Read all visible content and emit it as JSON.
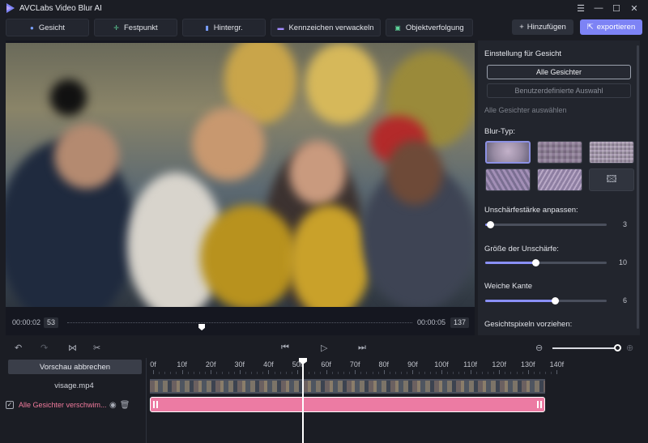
{
  "app": {
    "title": "AVCLabs Video Blur AI"
  },
  "window_controls": [
    "menu-icon",
    "minimize-icon",
    "maximize-icon",
    "close-icon"
  ],
  "tabs": [
    {
      "label": "Gesicht",
      "icon": "face-icon"
    },
    {
      "label": "Festpunkt",
      "icon": "crosshair-icon"
    },
    {
      "label": "Hintergr.",
      "icon": "background-icon"
    },
    {
      "label": "Kennzeichen verwackeln",
      "icon": "car-icon"
    },
    {
      "label": "Objektverfolgung",
      "icon": "tracking-icon"
    }
  ],
  "header_buttons": {
    "add": "Hinzufügen",
    "export": "exportieren"
  },
  "player": {
    "current_time": "00:00:02",
    "current_frame": "53",
    "end_time": "00:00:05",
    "total_frames": "137",
    "progress": 0.39
  },
  "panel": {
    "heading": "Einstellung für Gesicht",
    "all_faces_button": "Alle Gesichter",
    "custom_button": "Benutzerdefinierte Auswahl",
    "note": "Alle Gesichter auswählen",
    "blur_type_label": "Blur-Typ:",
    "blur_types": [
      "blur",
      "mosaic-large",
      "mosaic-small",
      "glass",
      "lines",
      "custom-image"
    ],
    "selected_blur_type": 0,
    "strength_label": "Unschärfestärke anpassen:",
    "strength_value": "3",
    "strength_fraction": 0.04,
    "size_label": "Größe der Unschärfe:",
    "size_value": "10",
    "size_fraction": 0.41,
    "soft_edge_label": "Weiche Kante",
    "soft_edge_value": "6",
    "soft_edge_fraction": 0.57,
    "preview_pixels_label": "Gesichtspixeln vorziehen:"
  },
  "timeline": {
    "cancel_preview": "Vorschau abbrechen",
    "file_name": "visage.mp4",
    "layer_name": "Alle Gesichter verschwim...",
    "ruler_labels": [
      "0f",
      "10f",
      "20f",
      "30f",
      "40f",
      "50f",
      "60f",
      "70f",
      "80f",
      "90f",
      "100f",
      "110f",
      "120f",
      "130f",
      "140f"
    ],
    "zoom_level": 1.0
  },
  "colors": {
    "accent": "#8a90f8",
    "export": "#7d83f5",
    "layer": "#ec7ba3",
    "layer_text": "#f07a9c"
  }
}
